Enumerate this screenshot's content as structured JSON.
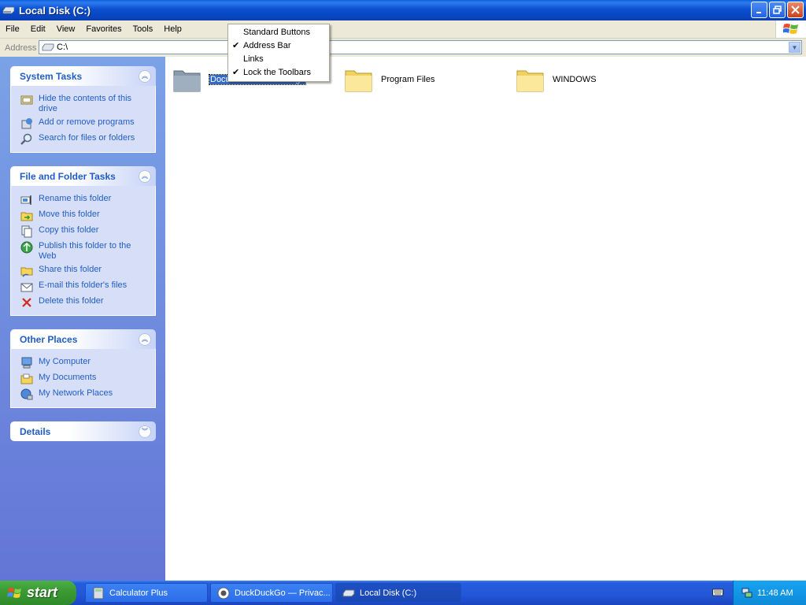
{
  "window": {
    "title": "Local Disk (C:)",
    "buttons": [
      "minimize",
      "restore",
      "close"
    ]
  },
  "menubar": {
    "items": [
      "File",
      "Edit",
      "View",
      "Favorites",
      "Tools",
      "Help"
    ]
  },
  "address": {
    "label": "Address",
    "value": "C:\\"
  },
  "context_menu": {
    "items": [
      {
        "label": "Standard Buttons",
        "checked": false
      },
      {
        "label": "Address Bar",
        "checked": true
      },
      {
        "label": "Links",
        "checked": false
      },
      {
        "label": "Lock the Toolbars",
        "checked": true
      }
    ]
  },
  "sidebar": {
    "system_tasks": {
      "title": "System Tasks",
      "items": [
        {
          "label": "Hide the contents of this drive",
          "icon": "hide-drive-icon"
        },
        {
          "label": "Add or remove programs",
          "icon": "add-remove-programs-icon"
        },
        {
          "label": "Search for files or folders",
          "icon": "search-icon"
        }
      ]
    },
    "file_folder_tasks": {
      "title": "File and Folder Tasks",
      "items": [
        {
          "label": "Rename this folder",
          "icon": "rename-icon"
        },
        {
          "label": "Move this folder",
          "icon": "move-icon"
        },
        {
          "label": "Copy this folder",
          "icon": "copy-icon"
        },
        {
          "label": "Publish this folder to the Web",
          "icon": "publish-web-icon"
        },
        {
          "label": "Share this folder",
          "icon": "share-icon"
        },
        {
          "label": "E-mail this folder's files",
          "icon": "email-icon"
        },
        {
          "label": "Delete this folder",
          "icon": "delete-icon"
        }
      ]
    },
    "other_places": {
      "title": "Other Places",
      "items": [
        {
          "label": "My Computer",
          "icon": "my-computer-icon"
        },
        {
          "label": "My Documents",
          "icon": "my-documents-icon"
        },
        {
          "label": "My Network Places",
          "icon": "network-places-icon"
        }
      ]
    },
    "details": {
      "title": "Details"
    }
  },
  "folders": [
    {
      "label": "Documents and Settings",
      "selected": true
    },
    {
      "label": "Program Files",
      "selected": false
    },
    {
      "label": "WINDOWS",
      "selected": false
    }
  ],
  "taskbar": {
    "start_label": "start",
    "tasks": [
      {
        "label": "Calculator Plus",
        "active": false
      },
      {
        "label": "DuckDuckGo — Privac...",
        "active": false
      },
      {
        "label": "Local Disk (C:)",
        "active": true
      }
    ],
    "clock": "11:48 AM"
  },
  "colors": {
    "title_bar": "#0a4fd0",
    "sidebar_link": "#215dc6",
    "selection": "#316ac5",
    "start": "#3c9b34"
  }
}
